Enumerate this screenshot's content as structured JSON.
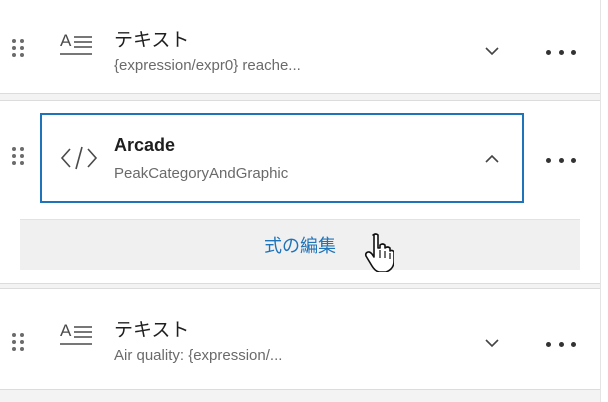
{
  "items": [
    {
      "title": "テキスト",
      "subtitle": "{expression/expr0} reache...",
      "icon": "text-align-icon",
      "expanded": false
    },
    {
      "title": "Arcade",
      "subtitle": "PeakCategoryAndGraphic",
      "icon": "code-icon",
      "expanded": true,
      "action_label": "式の編集"
    },
    {
      "title": "テキスト",
      "subtitle": "Air quality: {expression/...",
      "icon": "text-align-icon",
      "expanded": false
    }
  ],
  "colors": {
    "accent": "#1f73b8",
    "panel_bg": "#f3f3f3",
    "card_bg": "#ffffff"
  }
}
